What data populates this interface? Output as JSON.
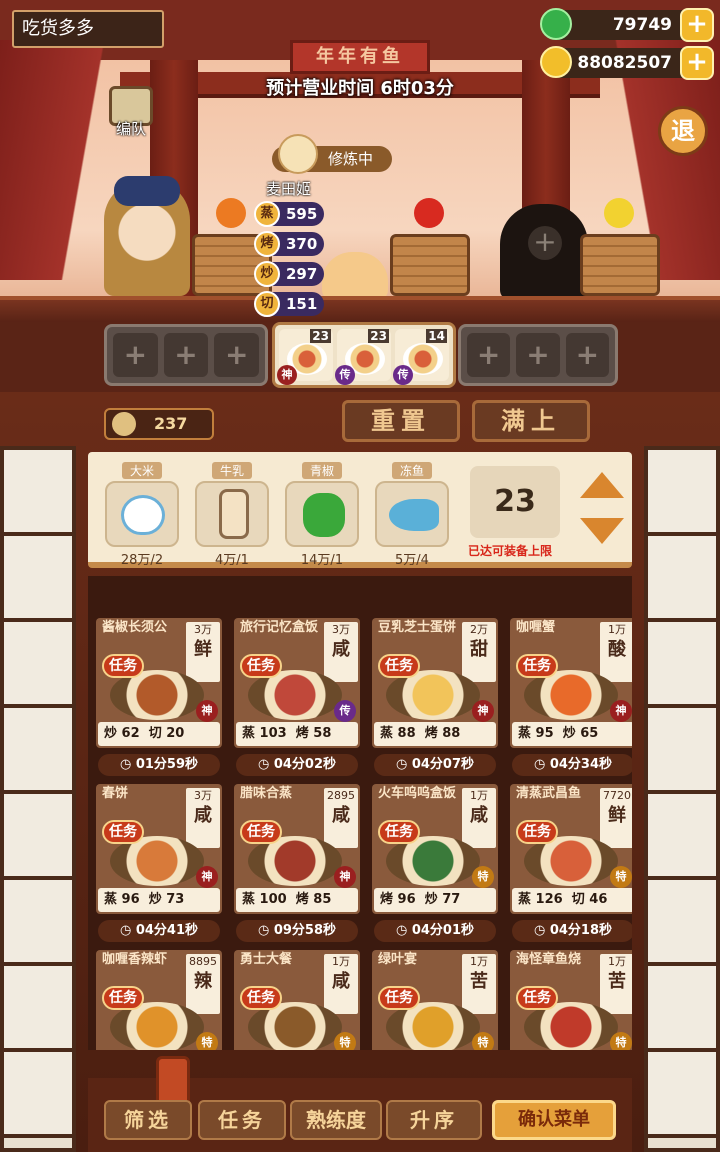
{
  "header": {
    "player_name": "吃货多多",
    "green_currency": "79749",
    "gold_currency": "88082507",
    "signboard": "年年有鱼",
    "business_time_label": "预计营业时间 6时03分",
    "team_label": "编队",
    "exit_label": "退"
  },
  "chef": {
    "status": "修炼中",
    "name": "麦田姬",
    "stats": [
      {
        "skill": "蒸",
        "value": "595",
        "color": "#3f4f9a"
      },
      {
        "skill": "烤",
        "value": "370",
        "color": "#3f4f9a"
      },
      {
        "skill": "炒",
        "value": "297",
        "color": "#3f4f9a"
      },
      {
        "skill": "切",
        "value": "151",
        "color": "#3f4f9a"
      }
    ]
  },
  "selected_dishes": [
    {
      "count": "23",
      "rank": "神"
    },
    {
      "count": "23",
      "rank": "传"
    },
    {
      "count": "14",
      "rank": "传"
    }
  ],
  "toolbar": {
    "stock": "237",
    "reset": "重置",
    "fill": "满上"
  },
  "ingredients": [
    {
      "name": "大米",
      "amount": "28万/2"
    },
    {
      "name": "牛乳",
      "amount": "4万/1"
    },
    {
      "name": "青椒",
      "amount": "14万/1"
    },
    {
      "name": "冻鱼",
      "amount": "5万/4"
    }
  ],
  "quantity": {
    "value": "23",
    "note": "已达可装备上限"
  },
  "dishes": [
    {
      "name": "酱椒长须公",
      "price": "3万",
      "taste": "鲜",
      "task": "任务",
      "rank": "神",
      "s1": "炒",
      "v1": "62",
      "s2": "切",
      "v2": "20",
      "time": "01分59秒"
    },
    {
      "name": "旅行记忆盒饭",
      "price": "3万",
      "taste": "咸",
      "task": "任务",
      "rank": "传",
      "s1": "蒸",
      "v1": "103",
      "s2": "烤",
      "v2": "58",
      "time": "04分02秒"
    },
    {
      "name": "豆乳芝士蛋饼",
      "price": "2万",
      "taste": "甜",
      "task": "任务",
      "rank": "神",
      "s1": "蒸",
      "v1": "88",
      "s2": "烤",
      "v2": "88",
      "time": "04分07秒"
    },
    {
      "name": "咖喱蟹",
      "price": "1万",
      "taste": "酸",
      "task": "任务",
      "rank": "神",
      "s1": "蒸",
      "v1": "95",
      "s2": "炒",
      "v2": "65",
      "time": "04分34秒"
    },
    {
      "name": "春饼",
      "price": "3万",
      "taste": "咸",
      "task": "任务",
      "rank": "神",
      "s1": "蒸",
      "v1": "96",
      "s2": "炒",
      "v2": "73",
      "time": "04分41秒"
    },
    {
      "name": "腊味合蒸",
      "price": "2895",
      "taste": "咸",
      "task": "任务",
      "rank": "神",
      "s1": "蒸",
      "v1": "100",
      "s2": "烤",
      "v2": "85",
      "time": "09分58秒"
    },
    {
      "name": "火车呜呜盒饭",
      "price": "1万",
      "taste": "咸",
      "task": "任务",
      "rank": "特",
      "s1": "烤",
      "v1": "96",
      "s2": "炒",
      "v2": "77",
      "time": "04分01秒"
    },
    {
      "name": "清蒸武昌鱼",
      "price": "7720",
      "taste": "鲜",
      "task": "任务",
      "rank": "特",
      "s1": "蒸",
      "v1": "126",
      "s2": "切",
      "v2": "46",
      "time": "04分18秒"
    },
    {
      "name": "咖喱香辣虾",
      "price": "8895",
      "taste": "辣",
      "task": "任务",
      "rank": "特",
      "s1": "",
      "v1": "",
      "s2": "",
      "v2": "",
      "time": ""
    },
    {
      "name": "勇士大餐",
      "price": "1万",
      "taste": "咸",
      "task": "任务",
      "rank": "特",
      "s1": "",
      "v1": "",
      "s2": "",
      "v2": "",
      "time": ""
    },
    {
      "name": "绿叶宴",
      "price": "1万",
      "taste": "苦",
      "task": "任务",
      "rank": "特",
      "s1": "",
      "v1": "",
      "s2": "",
      "v2": "",
      "time": ""
    },
    {
      "name": "海怪章鱼烧",
      "price": "1万",
      "taste": "苦",
      "task": "任务",
      "rank": "特",
      "s1": "",
      "v1": "",
      "s2": "",
      "v2": "",
      "time": ""
    }
  ],
  "bottom": {
    "filter": "筛选",
    "task": "任务",
    "proficiency": "熟练度",
    "ascending": "升序",
    "confirm": "确认菜单"
  },
  "colors": {
    "rank_god": "#9a1f1f",
    "rank_legend": "#6a2a8a",
    "rank_special": "#c27a14"
  }
}
